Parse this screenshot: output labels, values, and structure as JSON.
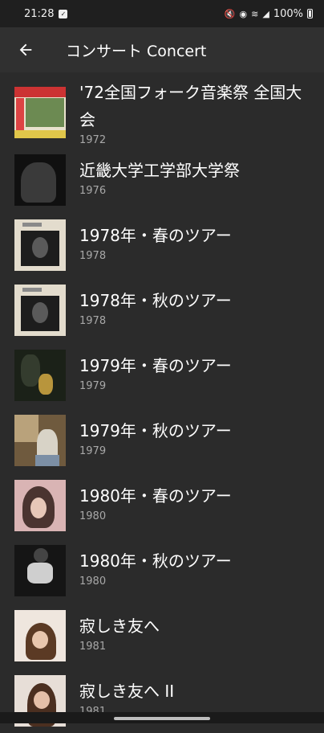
{
  "status_bar": {
    "time": "21:28",
    "battery": "100%"
  },
  "app_bar": {
    "back_icon": "arrow-left-icon",
    "title": "コンサート Concert"
  },
  "albums": [
    {
      "title": "'72全国フォーク音楽祭 全国大会",
      "year": "1972"
    },
    {
      "title": "近畿大学工学部大学祭",
      "year": "1976"
    },
    {
      "title": "1978年・春のツアー",
      "year": "1978"
    },
    {
      "title": "1978年・秋のツアー",
      "year": "1978"
    },
    {
      "title": "1979年・春のツアー",
      "year": "1979"
    },
    {
      "title": "1979年・秋のツアー",
      "year": "1979"
    },
    {
      "title": "1980年・春のツアー",
      "year": "1980"
    },
    {
      "title": "1980年・秋のツアー",
      "year": "1980"
    },
    {
      "title": "寂しき友へ",
      "year": "1981"
    },
    {
      "title": "寂しき友へ II",
      "year": "1981"
    }
  ]
}
